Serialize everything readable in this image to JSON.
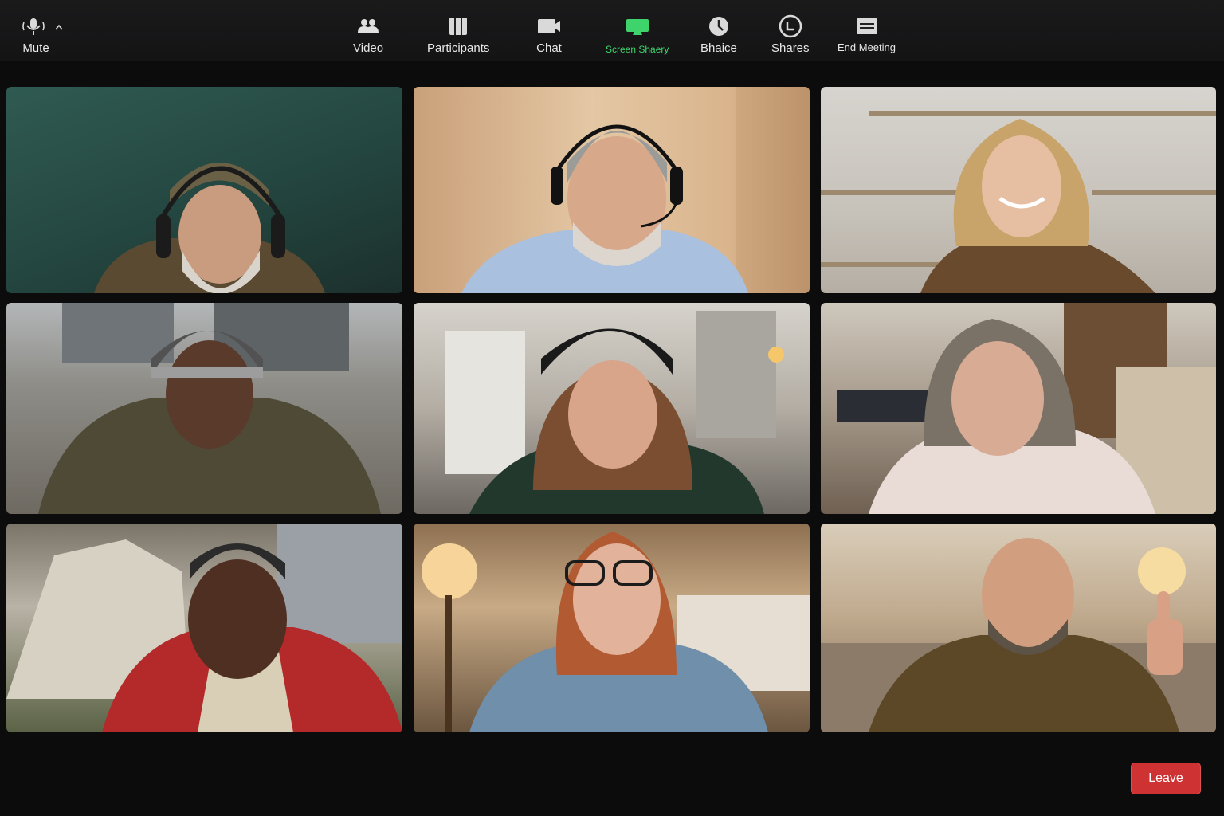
{
  "colors": {
    "background": "#0c0c0d",
    "leave_button": "#cf3232",
    "screen_share_accent": "#3fd46b",
    "label_text": "#e8e8e8"
  },
  "participants": [
    {
      "id": 1,
      "description_icon": "video-feed"
    },
    {
      "id": 2,
      "description_icon": "video-feed"
    },
    {
      "id": 3,
      "description_icon": "video-feed"
    },
    {
      "id": 4,
      "description_icon": "video-feed"
    },
    {
      "id": 5,
      "description_icon": "video-feed"
    },
    {
      "id": 6,
      "description_icon": "video-feed"
    },
    {
      "id": 7,
      "description_icon": "video-feed"
    },
    {
      "id": 8,
      "description_icon": "video-feed"
    },
    {
      "id": 9,
      "description_icon": "video-feed"
    }
  ],
  "toolbar": {
    "mute_label": "Mute",
    "video_label": "Video",
    "participants_label": "Participants",
    "chat_label": "Chat",
    "screen_share_label": "Screen Shaery",
    "bhaice_label": "Bhaice",
    "shares_label": "Shares",
    "end_meeting_label": "End Meeting",
    "leave_label": "Leave"
  }
}
